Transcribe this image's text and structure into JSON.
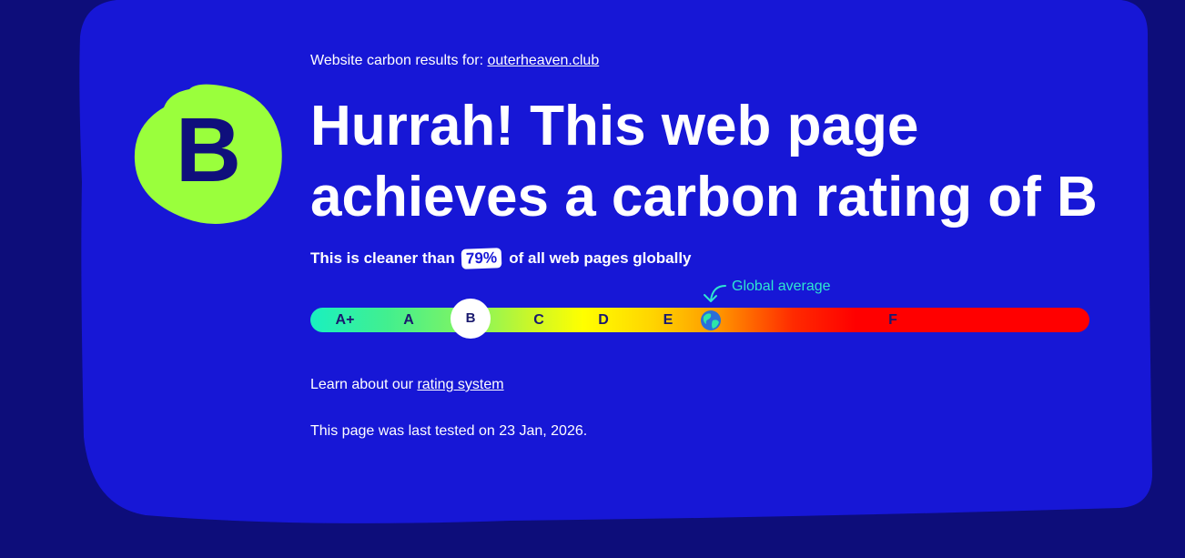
{
  "colors": {
    "page_background": "#0d0d7a",
    "panel": "#1717d6",
    "grade_blob": "#9aff3c",
    "accent": "#2ee6d0"
  },
  "result": {
    "prefix": "Website carbon results for:",
    "domain": "outerheaven.club"
  },
  "grade": {
    "letter": "B"
  },
  "headline": "Hurrah! This web page achieves a carbon rating of B",
  "cleaner": {
    "prefix": "This is cleaner than",
    "percent": "79%",
    "suffix": "of all web pages globally"
  },
  "scale": {
    "global_average_label": "Global average",
    "grades": [
      "A+",
      "A",
      "C",
      "D",
      "E",
      "F"
    ],
    "current_grade": "B",
    "globe_icon": "globe-icon"
  },
  "learn": {
    "prefix": "Learn about our",
    "link": "rating system"
  },
  "tested": "This page was last tested on 23 Jan, 2026."
}
